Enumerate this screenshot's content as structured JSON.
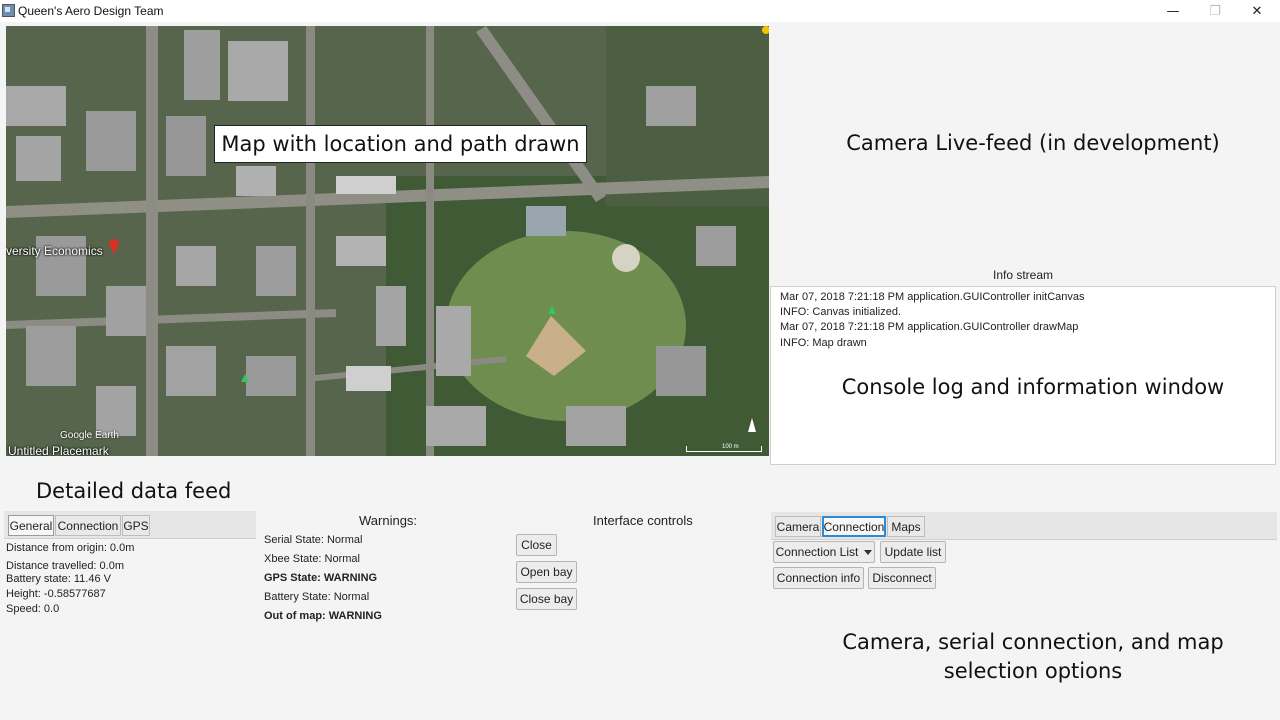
{
  "window": {
    "title": "Queen's Aero Design Team",
    "minimize_glyph": "—",
    "maximize_glyph": "❐",
    "close_glyph": "✕"
  },
  "map": {
    "caption": "Map with location and path drawn",
    "place_label": "versity Economics",
    "watermark": "Google Earth",
    "placemark_label": "Untitled Placemark",
    "scale_label": "100 m"
  },
  "camera": {
    "caption": "Camera Live-feed (in development)"
  },
  "info_stream": {
    "title": "Info stream",
    "log": [
      "Mar 07, 2018 7:21:18 PM application.GUIController initCanvas",
      "INFO: Canvas initialized.",
      "Mar 07, 2018 7:21:18 PM application.GUIController drawMap",
      "INFO: Map drawn"
    ],
    "caption": "Console log and information window"
  },
  "data_feed": {
    "caption": "Detailed data feed",
    "tabs": [
      "General",
      "Connection",
      "GPS"
    ],
    "active_tab": "General",
    "lines": [
      "Distance from origin: 0.0m",
      "Distance travelled: 0.0m",
      "Battery state: 11.46 V",
      "Height: -0.58577687",
      "Speed: 0.0"
    ]
  },
  "warnings": {
    "title": "Warnings:",
    "items": [
      {
        "text": "Serial State: Normal",
        "bold": false
      },
      {
        "text": "Xbee State: Normal",
        "bold": false
      },
      {
        "text": "GPS State: WARNING",
        "bold": true
      },
      {
        "text": "Battery State: Normal",
        "bold": false
      },
      {
        "text": "Out of map: WARNING",
        "bold": true
      }
    ]
  },
  "interface_controls": {
    "title": "Interface controls",
    "buttons": [
      "Close",
      "Open bay",
      "Close bay"
    ]
  },
  "options": {
    "tabs": [
      "Camera",
      "Connection",
      "Maps"
    ],
    "active_tab": "Connection",
    "connection_list_label": "Connection List",
    "update_list_label": "Update list",
    "connection_info_label": "Connection info",
    "disconnect_label": "Disconnect",
    "caption_line1": "Camera, serial connection, and map",
    "caption_line2": "selection options"
  }
}
